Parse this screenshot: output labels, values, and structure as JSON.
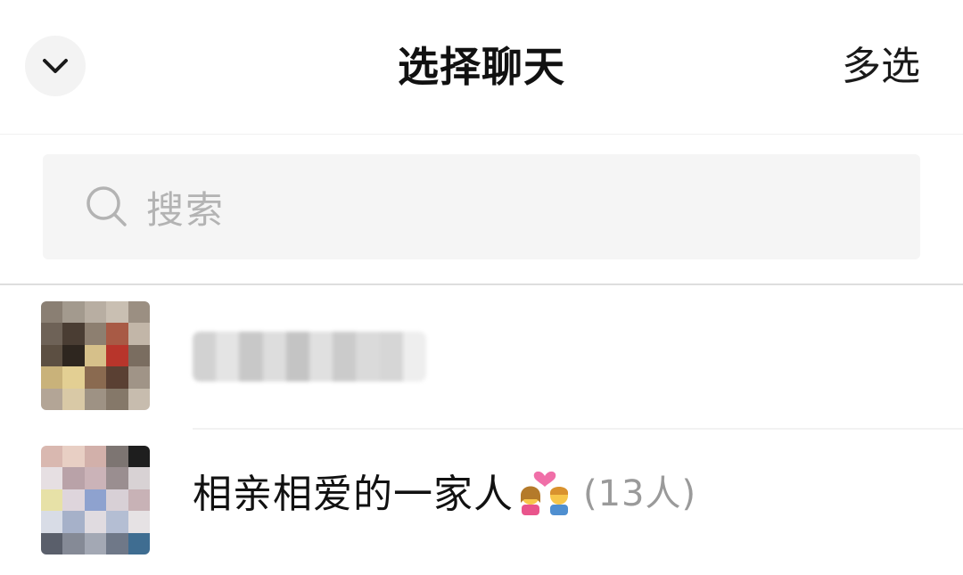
{
  "header": {
    "title": "选择聊天",
    "multi_select_label": "多选",
    "back_icon": "chevron-down-icon"
  },
  "search": {
    "placeholder": "搜索",
    "icon": "search-icon"
  },
  "chats": [
    {
      "name": "",
      "name_obscured": true,
      "avatar": "pixelated-avatar"
    },
    {
      "name": "相亲相爱的一家人",
      "emoji": "couple-with-heart-icon",
      "member_count": "(13人)",
      "avatar": "pixelated-group-avatar"
    }
  ],
  "colors": {
    "background": "#ffffff",
    "search_box": "#f5f5f5",
    "placeholder": "#b3b3b3",
    "member_count": "#9a9a9a",
    "divider": "#dedede"
  }
}
